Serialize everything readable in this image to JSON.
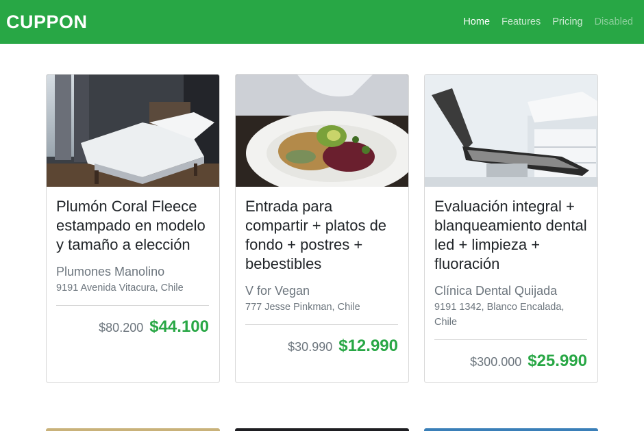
{
  "brand": "CUPPON",
  "nav": [
    {
      "label": "Home",
      "state": "active"
    },
    {
      "label": "Features",
      "state": "normal"
    },
    {
      "label": "Pricing",
      "state": "normal"
    },
    {
      "label": "Disabled",
      "state": "disabled"
    }
  ],
  "colors": {
    "accent": "#28a745"
  },
  "cards": [
    {
      "image": "bedroom-photo",
      "title": "Plumón Coral Fleece estampado en modelo y tamaño a elección",
      "merchant": "Plumones Manolino",
      "address": "9191 Avenida Vitacura, Chile",
      "old_price": "$80.200",
      "new_price": "$44.100"
    },
    {
      "image": "vegan-food-photo",
      "title": "Entrada para compartir + platos de fondo + postres + bebestibles",
      "merchant": "V for Vegan",
      "address": "777 Jesse Pinkman, Chile",
      "old_price": "$30.990",
      "new_price": "$12.990"
    },
    {
      "image": "dental-chair-photo",
      "title": "Evaluación integral + blanqueamiento dental led + limpieza + fluoración",
      "merchant": "Clínica Dental Quijada",
      "address": "9191 1342, Blanco Encalada, Chile",
      "old_price": "$300.000",
      "new_price": "$25.990"
    }
  ]
}
